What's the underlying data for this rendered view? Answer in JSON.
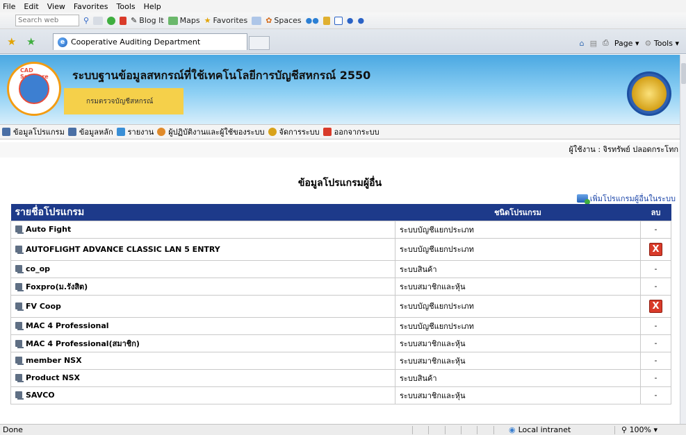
{
  "menubar": {
    "items": [
      "File",
      "Edit",
      "View",
      "Favorites",
      "Tools",
      "Help"
    ]
  },
  "toolbar": {
    "search_placeholder": "Search web",
    "blog_it": "Blog It",
    "maps": "Maps",
    "favorites": "Favorites",
    "spaces": "Spaces"
  },
  "tab": {
    "title": "Cooperative Auditing Department"
  },
  "cmdbar": {
    "page": "Page",
    "tools": "Tools"
  },
  "banner": {
    "title": "ระบบฐานข้อมูลสหกรณ์ที่ใช้เทคโนโลยีการบัญชีสหกรณ์ 2550",
    "subtitle": "กรมตรวจบัญชีสหกรณ์",
    "logo_text": "CAD Software Center"
  },
  "nav": {
    "items": [
      {
        "label": "ข้อมูลโปรแกรม",
        "color": "#4a6fa5"
      },
      {
        "label": "ข้อมูลหลัก",
        "color": "#4a6fa5"
      },
      {
        "label": "รายงาน",
        "color": "#3a8fd6"
      },
      {
        "label": "ผู้ปฏิบัติงานและผู้ใช้ของระบบ",
        "color": "#e08a2a"
      },
      {
        "label": "จัดการระบบ",
        "color": "#d8a21a"
      },
      {
        "label": "ออกจากระบบ",
        "color": "#d93b2a"
      }
    ]
  },
  "user": {
    "line": "ผู้ใช้งาน : จิรทรัพย์ ปลอดกระโทก"
  },
  "page": {
    "title": "ข้อมูลโปรแกรมผู้อื่น",
    "add_link": "เพิ่มโปรแกรมผู้อื่นในระบบ"
  },
  "table": {
    "headers": [
      "รายชื่อโปรแกรม",
      "ชนิดโปรแกรม",
      "ลบ"
    ],
    "rows": [
      {
        "name": "Auto Fight",
        "type": "ระบบบัญชีแยกประเภท",
        "del": "-"
      },
      {
        "name": "AUTOFLIGHT ADVANCE CLASSIC LAN 5 ENTRY",
        "type": "ระบบบัญชีแยกประเภท",
        "del": "X"
      },
      {
        "name": "co_op",
        "type": "ระบบสินค้า",
        "del": "-"
      },
      {
        "name": "Foxpro(ม.รังสิต)",
        "type": "ระบบสมาชิกและหุ้น",
        "del": "-"
      },
      {
        "name": "FV Coop",
        "type": "ระบบบัญชีแยกประเภท",
        "del": "X"
      },
      {
        "name": "MAC 4 Professional",
        "type": "ระบบบัญชีแยกประเภท",
        "del": "-"
      },
      {
        "name": "MAC 4 Professional(สมาชิก)",
        "type": "ระบบสมาชิกและหุ้น",
        "del": "-"
      },
      {
        "name": "member NSX",
        "type": "ระบบสมาชิกและหุ้น",
        "del": "-"
      },
      {
        "name": "Product NSX",
        "type": "ระบบสินค้า",
        "del": "-"
      },
      {
        "name": "SAVCO",
        "type": "ระบบสมาชิกและหุ้น",
        "del": "-"
      }
    ]
  },
  "status": {
    "left": "Done",
    "zone": "Local intranet",
    "zoom": "100%"
  }
}
